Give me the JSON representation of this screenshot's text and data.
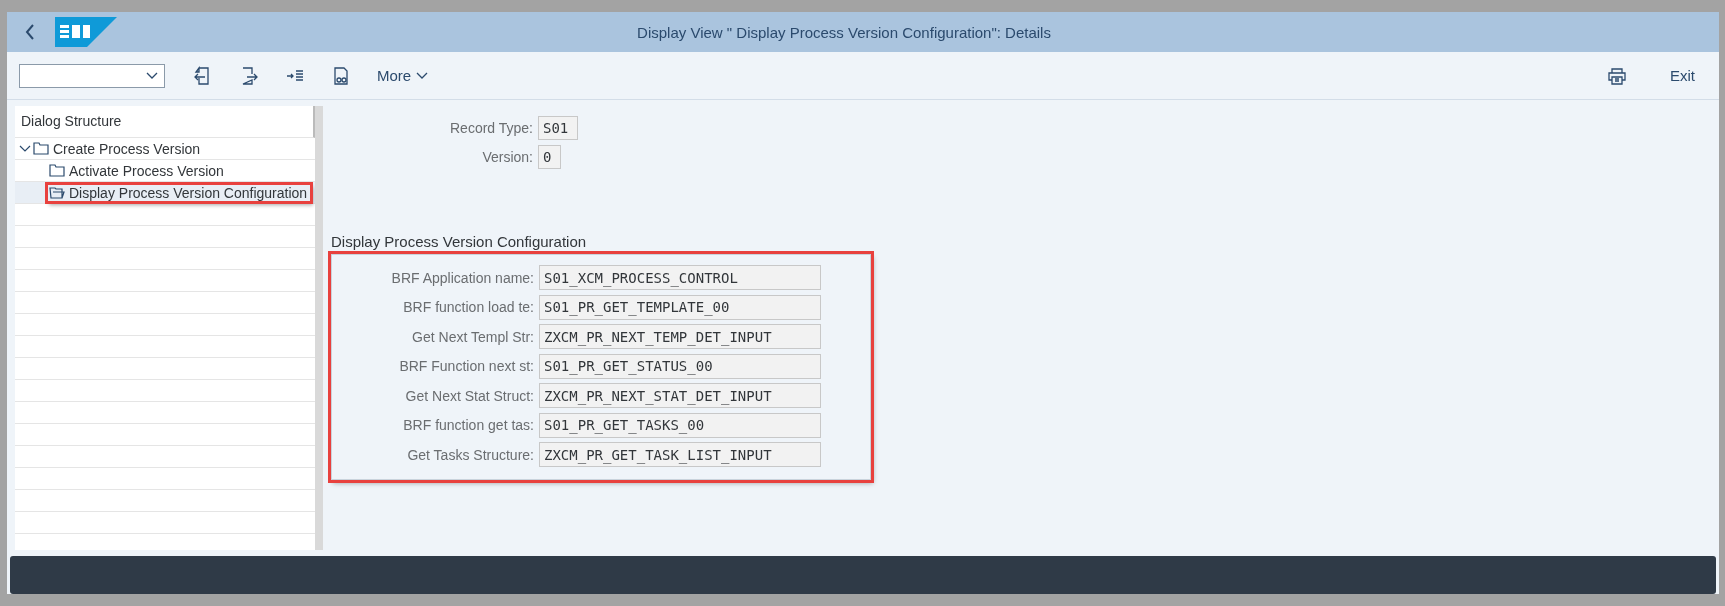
{
  "window": {
    "title": "Display View \" Display Process Version Configuration\": Details"
  },
  "toolbar": {
    "more_label": "More",
    "exit_label": "Exit"
  },
  "dialog_structure": {
    "title": "Dialog Structure",
    "items": [
      {
        "label": "Create Process Version",
        "expanded": true,
        "selected": false,
        "highlighted": false,
        "children": [
          {
            "label": "Activate Process Version",
            "selected": false,
            "highlighted": false
          },
          {
            "label": "Display Process Version Configuration",
            "selected": true,
            "highlighted": true
          }
        ]
      }
    ]
  },
  "header_fields": [
    {
      "label": "Record Type:",
      "value": "S01"
    },
    {
      "label": "Version:",
      "value": "0"
    }
  ],
  "section": {
    "title": "Display Process Version Configuration",
    "highlighted": true,
    "fields": [
      {
        "label": "BRF Application name:",
        "value": "S01_XCM_PROCESS_CONTROL"
      },
      {
        "label": "BRF function load te:",
        "value": "S01_PR_GET_TEMPLATE_00"
      },
      {
        "label": "Get Next Templ Str:",
        "value": "ZXCM_PR_NEXT_TEMP_DET_INPUT"
      },
      {
        "label": "BRF Function next st:",
        "value": "S01_PR_GET_STATUS_00"
      },
      {
        "label": "Get Next Stat Struct:",
        "value": "ZXCM_PR_NEXT_STAT_DET_INPUT"
      },
      {
        "label": "BRF function get tas:",
        "value": "S01_PR_GET_TASKS_00"
      },
      {
        "label": "Get Tasks Structure:",
        "value": "ZXCM_PR_GET_TASK_LIST_INPUT"
      }
    ]
  }
}
